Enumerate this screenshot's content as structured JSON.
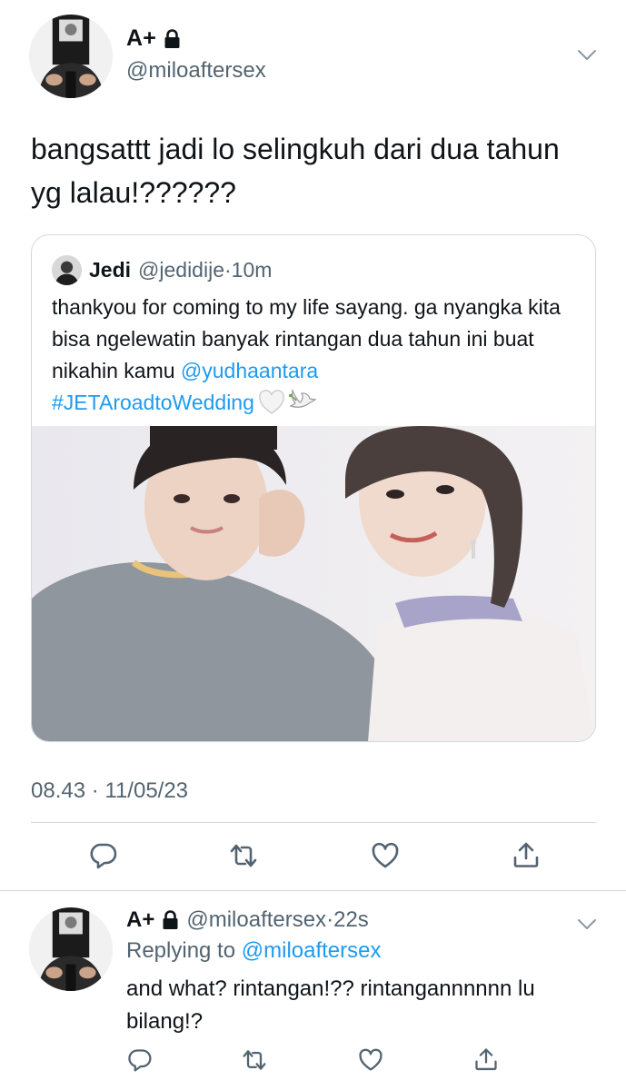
{
  "main_tweet": {
    "display_name": "A+",
    "handle": "@miloaftersex",
    "text": "bangsattt jadi lo selingkuh dari dua tahun yg lalau!??????",
    "timestamp": "08.43 · 11/05/23",
    "quote": {
      "name": "Jedi",
      "handle": "@jedidije",
      "separator": "·",
      "time": "10m",
      "text_plain": "thankyou for coming to my life sayang. ga nyangka kita bisa ngelewatin banyak rintangan dua tahun ini buat nikahin kamu ",
      "mention": "@yudhaantara",
      "hashtag": "#JETAroadtoWedding"
    }
  },
  "reply": {
    "display_name": "A+",
    "handle": "@miloaftersex",
    "separator": "·",
    "time": "22s",
    "replying_prefix": "Replying to ",
    "replying_handle": "@miloaftersex",
    "text": "and what? rintangan!?? rintangannnnnn lu bilang!?"
  },
  "icons": {
    "lock": "lock-icon",
    "caret": "chevron-down-icon",
    "reply": "reply-icon",
    "retweet": "retweet-icon",
    "like": "heart-icon",
    "share": "share-icon",
    "emoji_1": "white-heart-emoji",
    "emoji_2": "dove-emoji"
  },
  "colors": {
    "link": "#1d9bf0",
    "secondary_text": "#536471",
    "primary_text": "#0f1419",
    "border": "#cfd9de"
  }
}
